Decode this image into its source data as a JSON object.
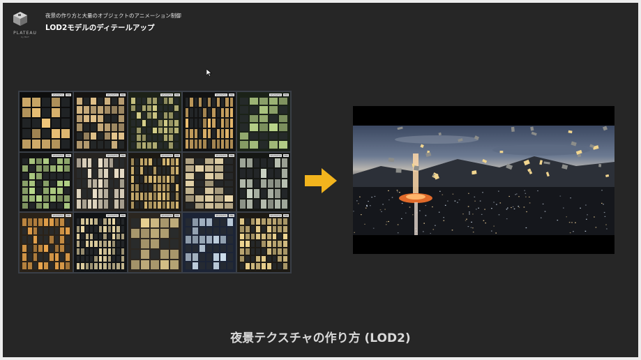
{
  "header": {
    "subtitle": "夜景の作り方と大量のオブジェクトのアニメーション制御",
    "title": "LOD2モデルのディテールアップ"
  },
  "logo": {
    "wordmark": "PLATEAU",
    "tagline": "by MLIT",
    "icon": "plateau-cube-icon"
  },
  "texture_grid": {
    "badge_label": "SEAMLESS",
    "badge_tag": "PBR",
    "tiles": [
      {
        "id": "t1",
        "bg": "#0d0d0d",
        "lit": "#f2c77a"
      },
      {
        "id": "t2",
        "bg": "#161412",
        "lit": "#e8c78e"
      },
      {
        "id": "t3",
        "bg": "#1d2218",
        "lit": "#d6cf8a"
      },
      {
        "id": "t4",
        "bg": "#121212",
        "lit": "#f0c070"
      },
      {
        "id": "t5",
        "bg": "#1b2218",
        "lit": "#b9d48a"
      },
      {
        "id": "t6",
        "bg": "#141414",
        "lit": "#b8d88a"
      },
      {
        "id": "t7",
        "bg": "#262320",
        "lit": "#f1e6cf"
      },
      {
        "id": "t8",
        "bg": "#1c1913",
        "lit": "#e2c27a"
      },
      {
        "id": "t9",
        "bg": "#1f1d1a",
        "lit": "#eedcb0"
      },
      {
        "id": "t10",
        "bg": "#151714",
        "lit": "#d0d8c8"
      },
      {
        "id": "t11",
        "bg": "#2a2218",
        "lit": "#e8a44c"
      },
      {
        "id": "t12",
        "bg": "#111315",
        "lit": "#e8d7a6"
      },
      {
        "id": "t13",
        "bg": "#2b2620",
        "lit": "#f0d898"
      },
      {
        "id": "t14",
        "bg": "#1c2436",
        "lit": "#cfe0ee"
      },
      {
        "id": "t15",
        "bg": "#1d1a14",
        "lit": "#f1d792"
      }
    ]
  },
  "arrow": {
    "color": "#f2b41d",
    "icon": "right-arrow-icon"
  },
  "caption": "夜景テクスチャの作り方 (LOD2)",
  "colors": {
    "slide_bg": "#262626",
    "grid_frame": "#3a3f47"
  }
}
